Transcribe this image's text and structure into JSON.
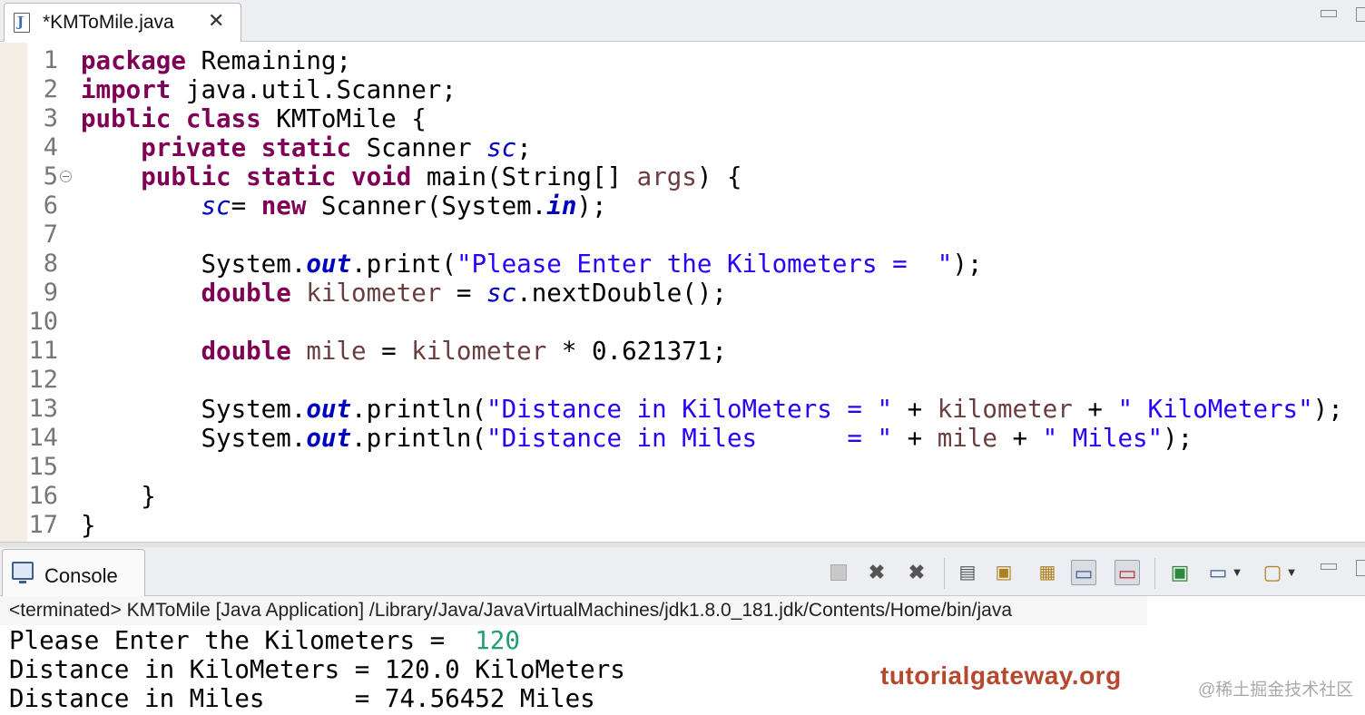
{
  "editor": {
    "tab_title": "*KMToMile.java",
    "tab_icon": "java-file-icon",
    "close_glyph": "✕",
    "lines": [
      {
        "n": "1",
        "segs": [
          {
            "t": "package",
            "c": "kw"
          },
          {
            "t": " Remaining;",
            "c": ""
          }
        ]
      },
      {
        "n": "2",
        "segs": [
          {
            "t": "import",
            "c": "kw"
          },
          {
            "t": " java.util.Scanner;",
            "c": ""
          }
        ]
      },
      {
        "n": "3",
        "segs": [
          {
            "t": "public",
            "c": "kw"
          },
          {
            "t": " ",
            "c": ""
          },
          {
            "t": "class",
            "c": "kw"
          },
          {
            "t": " KMToMile {",
            "c": ""
          }
        ]
      },
      {
        "n": "4",
        "segs": [
          {
            "t": "    ",
            "c": ""
          },
          {
            "t": "private",
            "c": "kw"
          },
          {
            "t": " ",
            "c": ""
          },
          {
            "t": "static",
            "c": "kw"
          },
          {
            "t": " Scanner ",
            "c": ""
          },
          {
            "t": "sc",
            "c": "fld"
          },
          {
            "t": ";",
            "c": ""
          }
        ]
      },
      {
        "n": "5",
        "fold": true,
        "segs": [
          {
            "t": "    ",
            "c": ""
          },
          {
            "t": "public",
            "c": "kw"
          },
          {
            "t": " ",
            "c": ""
          },
          {
            "t": "static",
            "c": "kw"
          },
          {
            "t": " ",
            "c": ""
          },
          {
            "t": "void",
            "c": "kw"
          },
          {
            "t": " main(String[] ",
            "c": ""
          },
          {
            "t": "args",
            "c": "var"
          },
          {
            "t": ") {",
            "c": ""
          }
        ]
      },
      {
        "n": "6",
        "segs": [
          {
            "t": "        ",
            "c": ""
          },
          {
            "t": "sc",
            "c": "fld"
          },
          {
            "t": "= ",
            "c": ""
          },
          {
            "t": "new",
            "c": "kw"
          },
          {
            "t": " Scanner(System.",
            "c": ""
          },
          {
            "t": "in",
            "c": "fldb"
          },
          {
            "t": ");",
            "c": ""
          }
        ]
      },
      {
        "n": "7",
        "segs": []
      },
      {
        "n": "8",
        "segs": [
          {
            "t": "        System.",
            "c": ""
          },
          {
            "t": "out",
            "c": "fldb"
          },
          {
            "t": ".print(",
            "c": ""
          },
          {
            "t": "\"Please Enter the Kilometers =  \"",
            "c": "str"
          },
          {
            "t": ");",
            "c": ""
          }
        ]
      },
      {
        "n": "9",
        "segs": [
          {
            "t": "        ",
            "c": ""
          },
          {
            "t": "double",
            "c": "kw"
          },
          {
            "t": " ",
            "c": ""
          },
          {
            "t": "kilometer",
            "c": "var"
          },
          {
            "t": " = ",
            "c": ""
          },
          {
            "t": "sc",
            "c": "fld"
          },
          {
            "t": ".nextDouble();",
            "c": ""
          }
        ]
      },
      {
        "n": "10",
        "segs": []
      },
      {
        "n": "11",
        "segs": [
          {
            "t": "        ",
            "c": ""
          },
          {
            "t": "double",
            "c": "kw"
          },
          {
            "t": " ",
            "c": ""
          },
          {
            "t": "mile",
            "c": "var"
          },
          {
            "t": " = ",
            "c": ""
          },
          {
            "t": "kilometer",
            "c": "var"
          },
          {
            "t": " * 0.621371;",
            "c": ""
          }
        ]
      },
      {
        "n": "12",
        "segs": []
      },
      {
        "n": "13",
        "segs": [
          {
            "t": "        System.",
            "c": ""
          },
          {
            "t": "out",
            "c": "fldb"
          },
          {
            "t": ".println(",
            "c": ""
          },
          {
            "t": "\"Distance in KiloMeters = \"",
            "c": "str"
          },
          {
            "t": " + ",
            "c": ""
          },
          {
            "t": "kilometer",
            "c": "var"
          },
          {
            "t": " + ",
            "c": ""
          },
          {
            "t": "\" KiloMeters\"",
            "c": "str"
          },
          {
            "t": ");",
            "c": ""
          }
        ]
      },
      {
        "n": "14",
        "segs": [
          {
            "t": "        System.",
            "c": ""
          },
          {
            "t": "out",
            "c": "fldb"
          },
          {
            "t": ".println(",
            "c": ""
          },
          {
            "t": "\"Distance in Miles      = \"",
            "c": "str"
          },
          {
            "t": " + ",
            "c": ""
          },
          {
            "t": "mile",
            "c": "var"
          },
          {
            "t": " + ",
            "c": ""
          },
          {
            "t": "\" Miles\"",
            "c": "str"
          },
          {
            "t": ");",
            "c": ""
          }
        ]
      },
      {
        "n": "15",
        "segs": []
      },
      {
        "n": "16",
        "segs": [
          {
            "t": "    }",
            "c": ""
          }
        ]
      },
      {
        "n": "17",
        "segs": [
          {
            "t": "}",
            "c": ""
          }
        ]
      }
    ]
  },
  "console": {
    "tab_title": "Console",
    "tab_icon": "console-icon",
    "status": "<terminated> KMToMile [Java Application] /Library/Java/JavaVirtualMachines/jdk1.8.0_181.jdk/Contents/Home/bin/java",
    "output": [
      {
        "text": "Please Enter the Kilometers =  ",
        "input": "120"
      },
      {
        "text": "Distance in KiloMeters = 120.0 KiloMeters",
        "input": ""
      },
      {
        "text": "Distance in Miles      = 74.56452 Miles",
        "input": ""
      }
    ],
    "toolbar_icons": [
      "terminate-icon",
      "remove-launch-icon",
      "remove-all-terminated-icon",
      "clear-console-icon",
      "scroll-lock-icon",
      "word-wrap-icon",
      "show-on-stdout-icon",
      "show-on-stderr-icon",
      "pin-console-icon",
      "display-console-icon",
      "open-console-icon",
      "minimize-icon",
      "maximize-icon"
    ]
  },
  "watermarks": {
    "site": "tutorialgateway.org",
    "community": "@稀土掘金技术社区"
  },
  "colors": {
    "keyword": "#7f0055",
    "field": "#0000c0",
    "string": "#2a00ff",
    "local_var": "#6a3e3e",
    "user_input": "#22a06b"
  }
}
